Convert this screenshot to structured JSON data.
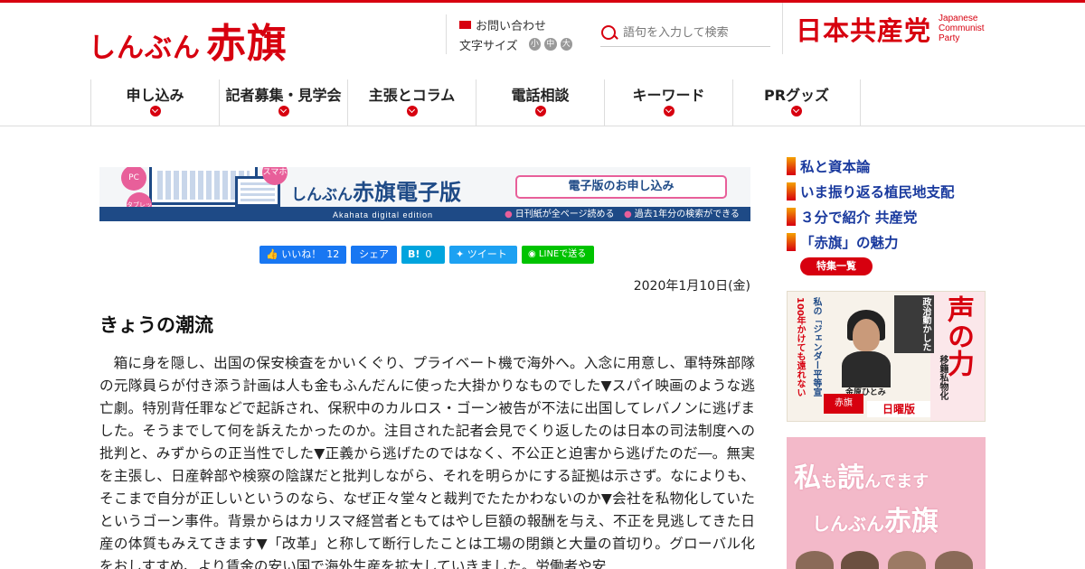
{
  "header": {
    "logo_small": "しんぶん",
    "logo_big": "赤旗",
    "contact_label": "お問い合わせ",
    "text_size_label": "文字サイズ",
    "text_sizes": [
      "小",
      "中",
      "大"
    ],
    "search_placeholder": "語句を入力して検索",
    "party_jp": "日本共産党",
    "party_en_1": "Japanese",
    "party_en_2": "Communist",
    "party_en_3": "Party"
  },
  "nav": [
    {
      "label": "申し込み"
    },
    {
      "label": "記者募集・見学会"
    },
    {
      "label": "主張とコラム"
    },
    {
      "label": "電話相談"
    },
    {
      "label": "キーワード"
    },
    {
      "label": "PRグッズ"
    }
  ],
  "banner": {
    "tag_pc": "PC",
    "tag_tablet": "タブレット",
    "tag_phone": "スマホ",
    "title_small": "しんぶん",
    "title_big": "赤旗電子版",
    "apply_label": "電子版のお申し込み",
    "subtitle": "Akahata digital edition",
    "feature_1": "日刊紙が全ページ読める",
    "feature_2": "過去1年分の検索ができる"
  },
  "share": {
    "like_label": "いいね！",
    "like_count": "12",
    "share_label": "シェア",
    "hatena_label": "B!",
    "hatena_count": "0",
    "tweet_label": "ツイート",
    "line_label": "LINEで送る"
  },
  "article": {
    "date": "2020年1月10日(金)",
    "title": "きょうの潮流",
    "body": "箱に身を隠し、出国の保安検査をかいくぐり、プライベート機で海外へ。入念に用意し、軍特殊部隊の元隊員らが付き添う計画は人も金もふんだんに使った大掛かりなものでした▼スパイ映画のような逃亡劇。特別背任罪などで起訴され、保釈中のカルロス・ゴーン被告が不法に出国してレバノンに逃げました。そうまでして何を訴えたかったのか。注目された記者会見でくり返したのは日本の司法制度への批判と、みずからの正当性でした▼正義から逃げたのではなく、不公正と迫害から逃げたのだ―。無実を主張し、日産幹部や検察の陰謀だと批判しながら、それを明らかにする証拠は示さず。なによりも、そこまで自分が正しいというのなら、なぜ正々堂々と裁判でたたかわないのか▼会社を私物化していたというゴーン事件。背景からはカリスマ経営者ともてはやし巨額の報酬を与え、不正を見逃してきた日産の体質もみえてきます▼「改革」と称して断行したことは工場の閉鎖と大量の首切り。グローバル化をおしすすめ、より賃金の安い国で海外生産を拡大していきました。労働者や安"
  },
  "sidebar": {
    "links": [
      {
        "label": "私と資本論"
      },
      {
        "label": "いま振り返る植民地支配"
      },
      {
        "label": "３分で紹介 共産党"
      },
      {
        "label": "「赤旗」の魅力"
      }
    ],
    "feature_list_label": "特集一覧",
    "promo1": {
      "headline": "政治動かした",
      "voice": "声の力",
      "col1": "100年かけても遠れない",
      "col2": "私の「ジェンダー平等宣言」",
      "col3": "移籍私物化NO",
      "name": "金原ひとみ",
      "edition": "日曜版",
      "paper": "赤旗"
    },
    "promo2": {
      "line1_a": "私",
      "line1_b": "も",
      "line1_c": "読",
      "line1_d": "んでます",
      "line2_a": "しんぶん",
      "line2_b": "赤旗"
    }
  },
  "colors": {
    "brand_red": "#d7000f",
    "link_blue": "#1a3a9e",
    "banner_navy": "#1e4a86",
    "accent_pink": "#e85f9a"
  }
}
